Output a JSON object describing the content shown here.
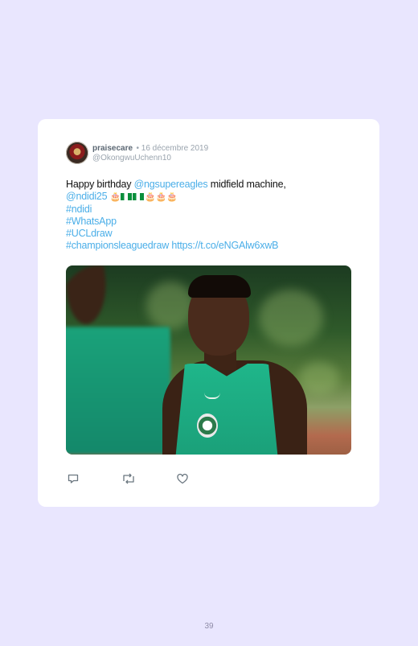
{
  "tweet": {
    "username": "praisecare",
    "date": "• 16 décembre 2019",
    "handle": "@OkongwuUchenn10",
    "line1_text": "Happy birthday ",
    "mention1": "@ngsupereagles",
    "line1_rest": " midfield machine,",
    "mention2": "@ndidi25",
    "hashtags": [
      "#ndidi",
      "#WhatsApp",
      "#UCLdraw"
    ],
    "last_hashtag": "#championsleaguedraw",
    "link": "https://t.co/eNGAlw6xwB"
  },
  "icons": {
    "reply": "reply-icon",
    "retweet": "retweet-icon",
    "like": "heart-icon"
  },
  "page": {
    "number": "39"
  },
  "colors": {
    "background": "#e9e6fe",
    "link": "#4aaee8",
    "card": "#ffffff"
  }
}
